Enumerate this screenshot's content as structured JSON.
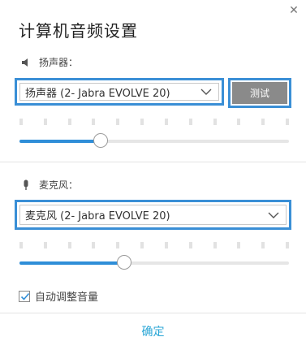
{
  "dialog": {
    "title": "计算机音频设置",
    "close_icon": "close-icon"
  },
  "speaker": {
    "label": "扬声器：",
    "icon": "speaker-icon",
    "selected": "扬声器 (2- Jabra EVOLVE 20)",
    "test_label": "测试",
    "volume": 0.3
  },
  "microphone": {
    "label": "麦克风：",
    "icon": "microphone-icon",
    "selected": "麦克风 (2- Jabra EVOLVE 20)",
    "volume": 0.39
  },
  "auto_adjust": {
    "label": "自动调整音量",
    "checked": true
  },
  "footer": {
    "ok_label": "确定"
  },
  "colors": {
    "accent": "#2f8ed8",
    "focus_border": "#3a8fd6",
    "link": "#2aa6d6",
    "test_button": "#8a8a8a"
  }
}
